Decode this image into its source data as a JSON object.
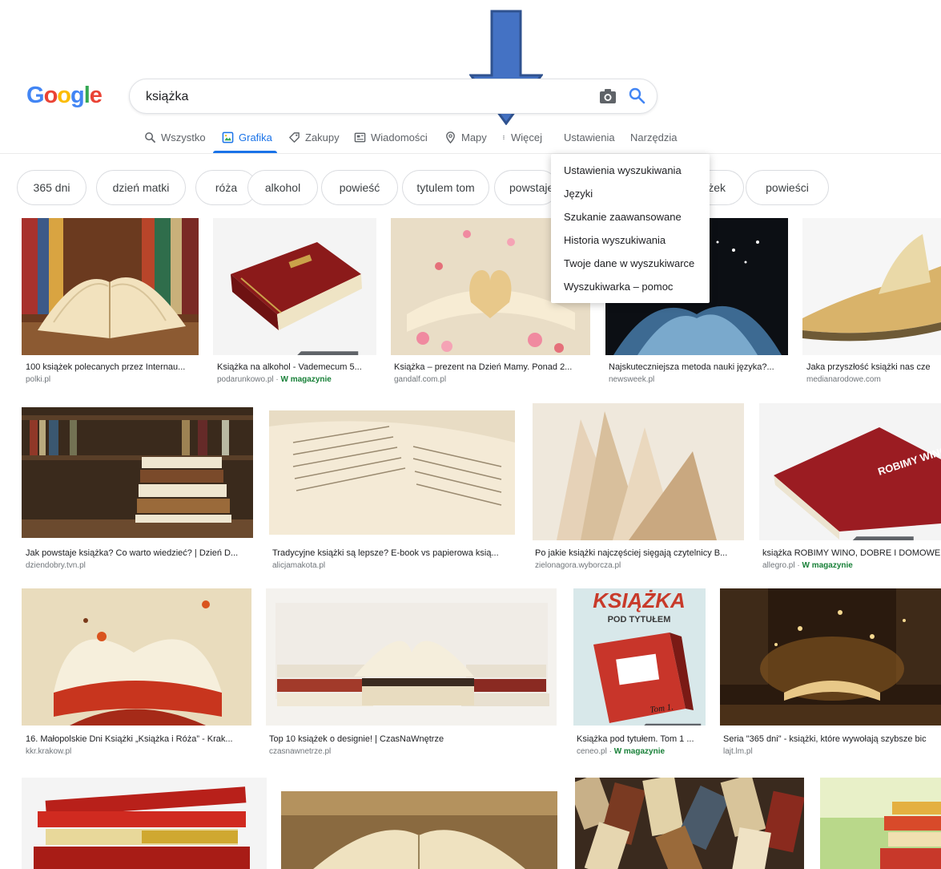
{
  "logo": [
    "G",
    "o",
    "o",
    "g",
    "l",
    "e"
  ],
  "search": {
    "value": "książka"
  },
  "tabs": [
    {
      "label": "Wszystko",
      "icon": "search-icon"
    },
    {
      "label": "Grafika",
      "icon": "image-icon",
      "active": true
    },
    {
      "label": "Zakupy",
      "icon": "tag-icon"
    },
    {
      "label": "Wiadomości",
      "icon": "news-icon"
    },
    {
      "label": "Mapy",
      "icon": "map-pin-icon"
    },
    {
      "label": "Więcej",
      "icon": "more-vert-icon"
    },
    {
      "label": "Ustawienia"
    },
    {
      "label": "Narzędzia"
    }
  ],
  "chips": [
    "365 dni",
    "dzień matki",
    "róża",
    "alkohol",
    "powieść",
    "tytulem tom",
    "powstaje",
    "żek",
    "powieści"
  ],
  "dropdown": [
    "Ustawienia wyszukiwania",
    "Języki",
    "Szukanie zaawansowane",
    "Historia wyszukiwania",
    "Twoje dane w wyszukiwarce",
    "Wyszukiwarka – pomoc"
  ],
  "results": [
    {
      "caption": "100 książek polecanych przez Internau...",
      "source": "polki.pl"
    },
    {
      "caption": "Książka na alkohol - Vademecum 5...",
      "source": "podarunkowo.pl",
      "stock": "W magazynie"
    },
    {
      "caption": "Książka – prezent na Dzień Mamy. Ponad 2...",
      "source": "gandalf.com.pl"
    },
    {
      "caption": "Najskuteczniejsza metoda nauki języka?...",
      "source": "newsweek.pl"
    },
    {
      "caption": "Jaka przyszłość książki nas cze",
      "source": "medianarodowe.com"
    },
    {
      "caption": "Jak powstaje książka? Co warto wiedzieć? | Dzień D...",
      "source": "dziendobry.tvn.pl"
    },
    {
      "caption": "Tradycyjne książki są lepsze? E-book vs papierowa ksią...",
      "source": "alicjamakota.pl"
    },
    {
      "caption": "Po jakie książki najczęściej sięgają czytelnicy B...",
      "source": "zielonagora.wyborcza.pl"
    },
    {
      "caption": "książka ROBIMY WINO, DOBRE I DOMOWE",
      "source": "allegro.pl",
      "stock": "W magazynie"
    },
    {
      "caption": "16. Małopolskie Dni Książki „Książka i Róża” - Krak...",
      "source": "kkr.krakow.pl"
    },
    {
      "caption": "Top 10 książek o designie! | CzasNaWnętrze",
      "source": "czasnawnetrze.pl"
    },
    {
      "caption": "Książka pod tytułem. Tom 1 ...",
      "source": "ceneo.pl",
      "stock": "W magazynie"
    },
    {
      "caption": "Seria \"365 dni\" - książki, które wywołają szybsze bic",
      "source": "lajt.lm.pl"
    }
  ],
  "image_texts": {
    "robimy_wino": "ROBIMY WINO",
    "ksiazka_title": "KSIĄŻKA",
    "pod_tytulem": "POD TYTUŁEM",
    "tom": "Tom 1."
  },
  "colors": {
    "accent": "#1a73e8",
    "arrow": "#4472c4",
    "stock_green": "#188038"
  }
}
